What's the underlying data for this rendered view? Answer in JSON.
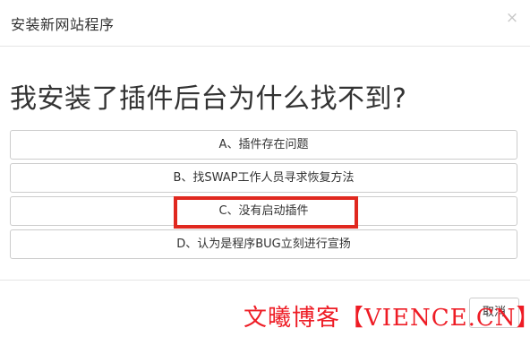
{
  "dialog": {
    "title": "安装新网站程序",
    "close_glyph": "×",
    "close_icon": "close-icon"
  },
  "question": "我安装了插件后台为什么找不到?",
  "options": [
    {
      "label": "A、插件存在问题"
    },
    {
      "label": "B、找SWAP工作人员寻求恢复方法"
    },
    {
      "label": "C、没有启动插件"
    },
    {
      "label": "D、认为是程序BUG立刻进行宣扬"
    }
  ],
  "highlight": {
    "target": "C、没有启动插件",
    "color": "#e0281f"
  },
  "footer": {
    "cancel_label": "取消"
  },
  "watermark": {
    "text": "文曦博客【VIENCE.CN】",
    "color": "#ee1c25"
  }
}
